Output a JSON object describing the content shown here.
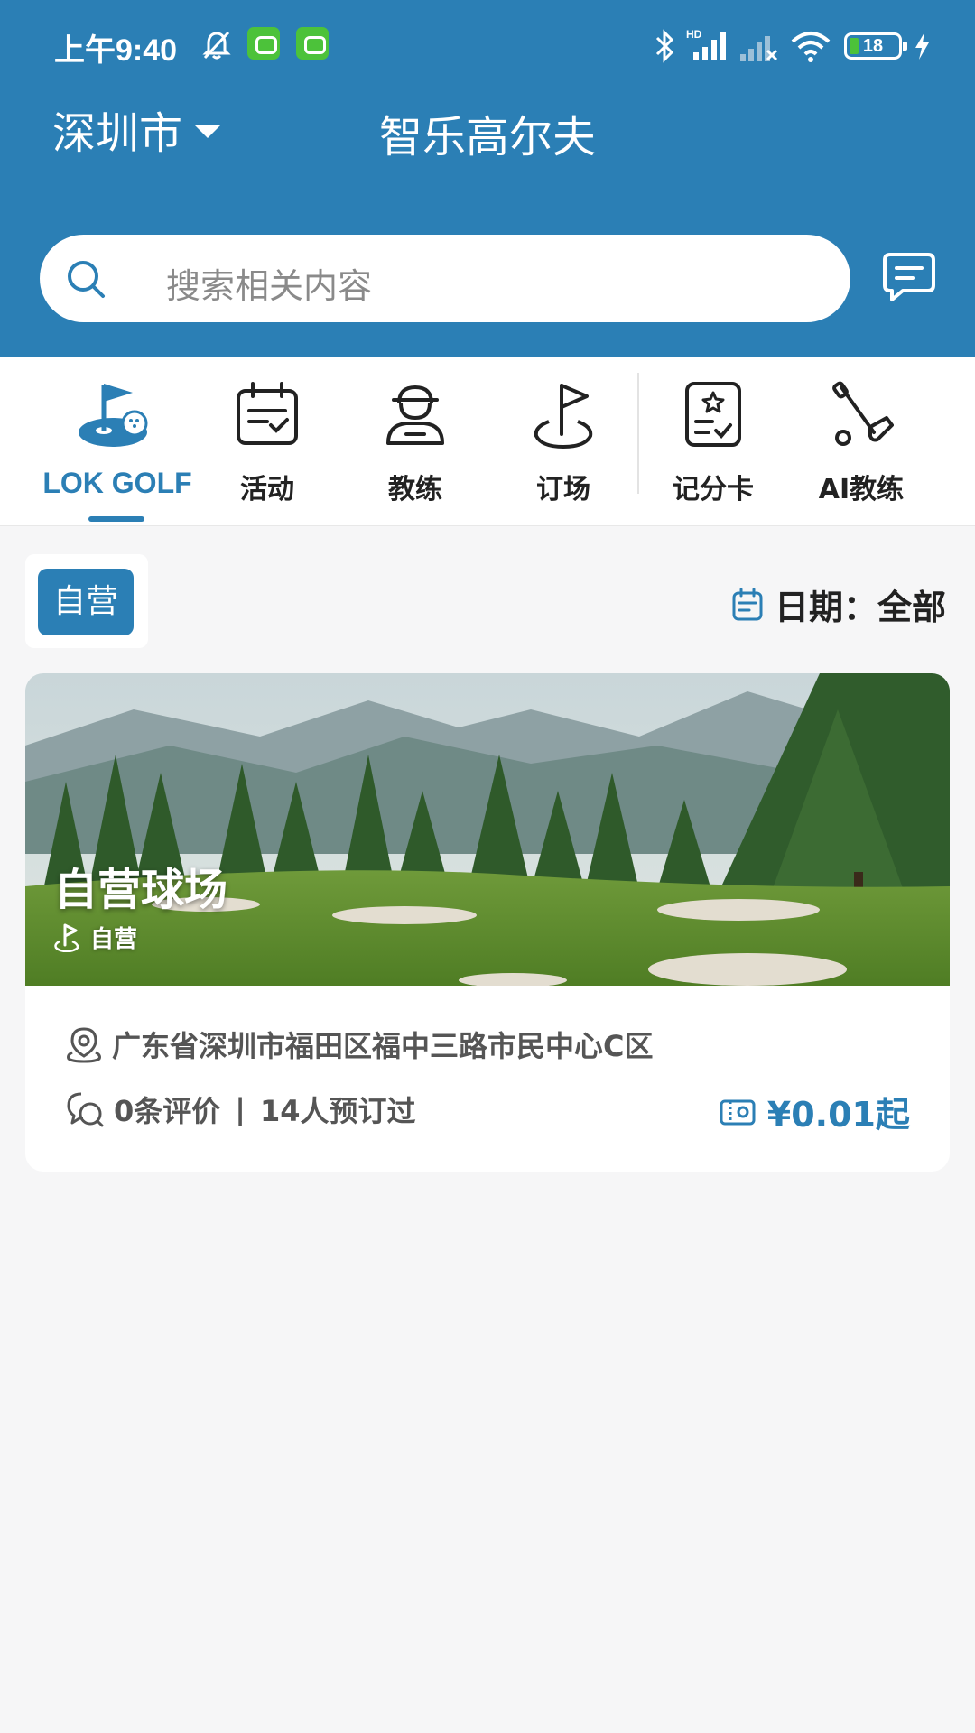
{
  "status_bar": {
    "time": "上午9:40",
    "battery": "18",
    "icons": [
      "mute-bell-icon",
      "app-badge-icon",
      "app-badge-icon",
      "bluetooth-icon",
      "hd-signal-icon",
      "no-signal-icon",
      "wifi-icon",
      "battery-icon",
      "charging-icon"
    ]
  },
  "header": {
    "city": "深圳市",
    "title": "智乐高尔夫",
    "search_placeholder": "搜索相关内容",
    "accent_color": "#2b7fb5"
  },
  "nav": {
    "items": [
      {
        "label": "LOK GOLF",
        "icon": "golf-ball-flag-icon",
        "active": true
      },
      {
        "label": "活动",
        "icon": "calendar-icon",
        "active": false
      },
      {
        "label": "教练",
        "icon": "coach-icon",
        "active": false
      },
      {
        "label": "订场",
        "icon": "flag-icon",
        "active": false
      },
      {
        "label": "记分卡",
        "icon": "scorecard-icon",
        "active": false
      },
      {
        "label": "AI教练",
        "icon": "golf-club-icon",
        "active": false
      }
    ]
  },
  "filters": {
    "tag": "自营",
    "date_label": "日期：",
    "date_value": "全部"
  },
  "courses": [
    {
      "title": "自营球场",
      "tag": "自营",
      "address": "广东省深圳市福田区福中三路市民中心C区",
      "reviews": "0条评价",
      "separator": "|",
      "bookings": "14人预订过",
      "price": "¥0.01起"
    }
  ]
}
